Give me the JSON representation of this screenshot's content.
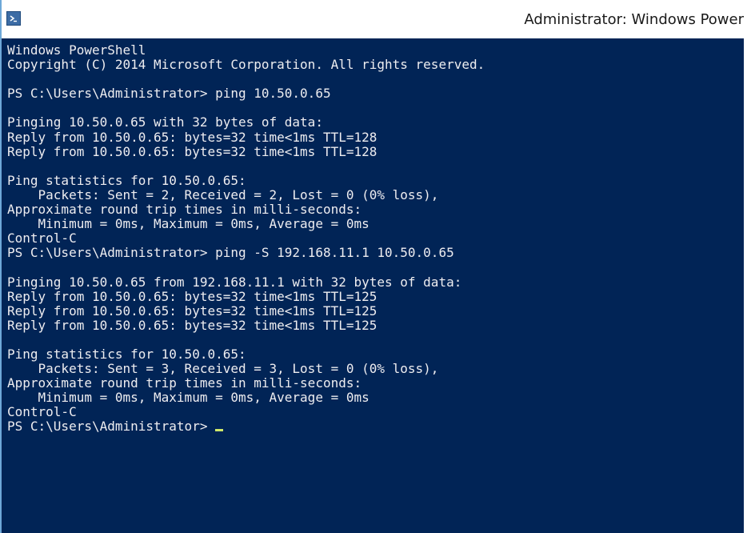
{
  "window": {
    "title": "Administrator: Windows Power",
    "icon": "powershell-icon",
    "colors": {
      "console_background": "#012456",
      "console_text": "#eeedf0",
      "cursor": "#cfe86a",
      "titlebar_background": "#ffffff"
    }
  },
  "console": {
    "lines": [
      "Windows PowerShell",
      "Copyright (C) 2014 Microsoft Corporation. All rights reserved.",
      "",
      "PS C:\\Users\\Administrator> ping 10.50.0.65",
      "",
      "Pinging 10.50.0.65 with 32 bytes of data:",
      "Reply from 10.50.0.65: bytes=32 time<1ms TTL=128",
      "Reply from 10.50.0.65: bytes=32 time<1ms TTL=128",
      "",
      "Ping statistics for 10.50.0.65:",
      "    Packets: Sent = 2, Received = 2, Lost = 0 (0% loss),",
      "Approximate round trip times in milli-seconds:",
      "    Minimum = 0ms, Maximum = 0ms, Average = 0ms",
      "Control-C",
      "PS C:\\Users\\Administrator> ping -S 192.168.11.1 10.50.0.65",
      "",
      "Pinging 10.50.0.65 from 192.168.11.1 with 32 bytes of data:",
      "Reply from 10.50.0.65: bytes=32 time<1ms TTL=125",
      "Reply from 10.50.0.65: bytes=32 time<1ms TTL=125",
      "Reply from 10.50.0.65: bytes=32 time<1ms TTL=125",
      "",
      "Ping statistics for 10.50.0.65:",
      "    Packets: Sent = 3, Received = 3, Lost = 0 (0% loss),",
      "Approximate round trip times in milli-seconds:",
      "    Minimum = 0ms, Maximum = 0ms, Average = 0ms",
      "Control-C"
    ],
    "prompt": "PS C:\\Users\\Administrator> "
  }
}
